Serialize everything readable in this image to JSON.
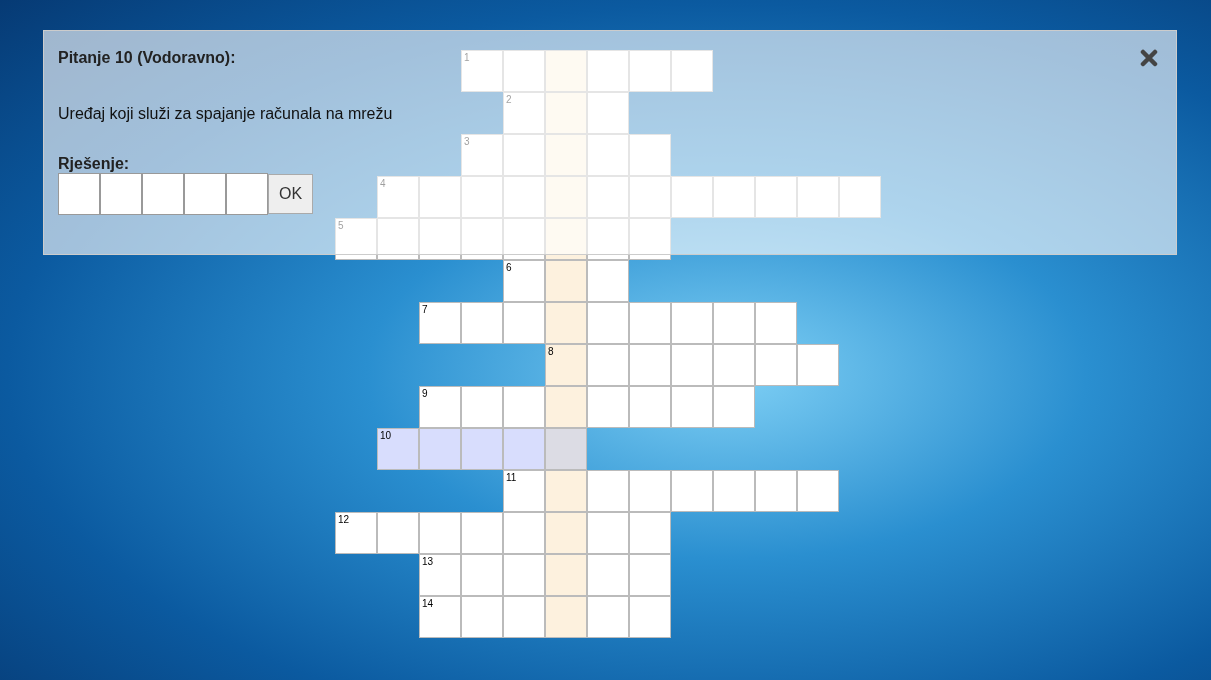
{
  "crossword": {
    "rows": [
      {
        "number": "1",
        "selected": false,
        "cells": [
          {
            "kind": "gap"
          },
          {
            "kind": "gap"
          },
          {
            "kind": "gap"
          },
          {
            "kind": "letter"
          },
          {
            "kind": "letter"
          },
          {
            "kind": "key"
          },
          {
            "kind": "letter"
          },
          {
            "kind": "letter"
          },
          {
            "kind": "letter"
          }
        ]
      },
      {
        "number": "2",
        "selected": false,
        "cells": [
          {
            "kind": "gap"
          },
          {
            "kind": "gap"
          },
          {
            "kind": "gap"
          },
          {
            "kind": "gap"
          },
          {
            "kind": "letter"
          },
          {
            "kind": "key"
          },
          {
            "kind": "letter"
          }
        ]
      },
      {
        "number": "3",
        "selected": false,
        "cells": [
          {
            "kind": "gap"
          },
          {
            "kind": "gap"
          },
          {
            "kind": "gap"
          },
          {
            "kind": "letter"
          },
          {
            "kind": "letter"
          },
          {
            "kind": "key"
          },
          {
            "kind": "letter"
          },
          {
            "kind": "letter"
          }
        ]
      },
      {
        "number": "4",
        "selected": false,
        "cells": [
          {
            "kind": "gap"
          },
          {
            "kind": "letter"
          },
          {
            "kind": "letter"
          },
          {
            "kind": "letter"
          },
          {
            "kind": "letter"
          },
          {
            "kind": "key"
          },
          {
            "kind": "letter"
          },
          {
            "kind": "letter"
          },
          {
            "kind": "letter"
          },
          {
            "kind": "letter"
          },
          {
            "kind": "letter"
          },
          {
            "kind": "letter"
          },
          {
            "kind": "letter"
          }
        ]
      },
      {
        "number": "5",
        "selected": false,
        "cells": [
          {
            "kind": "letter"
          },
          {
            "kind": "letter"
          },
          {
            "kind": "letter"
          },
          {
            "kind": "letter"
          },
          {
            "kind": "letter"
          },
          {
            "kind": "key"
          },
          {
            "kind": "letter"
          },
          {
            "kind": "letter"
          }
        ]
      },
      {
        "number": "6",
        "selected": false,
        "cells": [
          {
            "kind": "gap"
          },
          {
            "kind": "gap"
          },
          {
            "kind": "gap"
          },
          {
            "kind": "gap"
          },
          {
            "kind": "letter"
          },
          {
            "kind": "key"
          },
          {
            "kind": "letter"
          }
        ]
      },
      {
        "number": "7",
        "selected": false,
        "cells": [
          {
            "kind": "gap"
          },
          {
            "kind": "gap"
          },
          {
            "kind": "letter"
          },
          {
            "kind": "letter"
          },
          {
            "kind": "letter"
          },
          {
            "kind": "key"
          },
          {
            "kind": "letter"
          },
          {
            "kind": "letter"
          },
          {
            "kind": "letter"
          },
          {
            "kind": "letter"
          },
          {
            "kind": "letter"
          }
        ]
      },
      {
        "number": "8",
        "selected": false,
        "cells": [
          {
            "kind": "gap"
          },
          {
            "kind": "gap"
          },
          {
            "kind": "gap"
          },
          {
            "kind": "gap"
          },
          {
            "kind": "gap"
          },
          {
            "kind": "key"
          },
          {
            "kind": "letter"
          },
          {
            "kind": "letter"
          },
          {
            "kind": "letter"
          },
          {
            "kind": "letter"
          },
          {
            "kind": "letter"
          },
          {
            "kind": "letter"
          }
        ]
      },
      {
        "number": "9",
        "selected": false,
        "cells": [
          {
            "kind": "gap"
          },
          {
            "kind": "gap"
          },
          {
            "kind": "letter"
          },
          {
            "kind": "letter"
          },
          {
            "kind": "letter"
          },
          {
            "kind": "key"
          },
          {
            "kind": "letter"
          },
          {
            "kind": "letter"
          },
          {
            "kind": "letter"
          },
          {
            "kind": "letter"
          }
        ]
      },
      {
        "number": "10",
        "selected": true,
        "cells": [
          {
            "kind": "gap"
          },
          {
            "kind": "letter"
          },
          {
            "kind": "letter"
          },
          {
            "kind": "letter"
          },
          {
            "kind": "letter"
          },
          {
            "kind": "key"
          }
        ]
      },
      {
        "number": "11",
        "selected": false,
        "cells": [
          {
            "kind": "gap"
          },
          {
            "kind": "gap"
          },
          {
            "kind": "gap"
          },
          {
            "kind": "gap"
          },
          {
            "kind": "letter"
          },
          {
            "kind": "key"
          },
          {
            "kind": "letter"
          },
          {
            "kind": "letter"
          },
          {
            "kind": "letter"
          },
          {
            "kind": "letter"
          },
          {
            "kind": "letter"
          },
          {
            "kind": "letter"
          }
        ]
      },
      {
        "number": "12",
        "selected": false,
        "cells": [
          {
            "kind": "letter"
          },
          {
            "kind": "letter"
          },
          {
            "kind": "letter"
          },
          {
            "kind": "letter"
          },
          {
            "kind": "letter"
          },
          {
            "kind": "key"
          },
          {
            "kind": "letter"
          },
          {
            "kind": "letter"
          }
        ]
      },
      {
        "number": "13",
        "selected": false,
        "cells": [
          {
            "kind": "gap"
          },
          {
            "kind": "gap"
          },
          {
            "kind": "letter"
          },
          {
            "kind": "letter"
          },
          {
            "kind": "letter"
          },
          {
            "kind": "key"
          },
          {
            "kind": "letter"
          },
          {
            "kind": "letter"
          }
        ]
      },
      {
        "number": "14",
        "selected": false,
        "cells": [
          {
            "kind": "gap"
          },
          {
            "kind": "gap"
          },
          {
            "kind": "letter"
          },
          {
            "kind": "letter"
          },
          {
            "kind": "letter"
          },
          {
            "kind": "key"
          },
          {
            "kind": "letter"
          },
          {
            "kind": "letter"
          }
        ]
      }
    ]
  },
  "question_dialog": {
    "title": "Pitanje 10 (Vodoravno):",
    "question": "Uređaj koji služi za spajanje računala na mrežu",
    "answer_label": "Rješenje:",
    "answer_boxes": [
      {
        "kind": "letter"
      },
      {
        "kind": "letter"
      },
      {
        "kind": "letter"
      },
      {
        "kind": "letter"
      },
      {
        "kind": "letter"
      }
    ],
    "ok_button": "OK"
  }
}
